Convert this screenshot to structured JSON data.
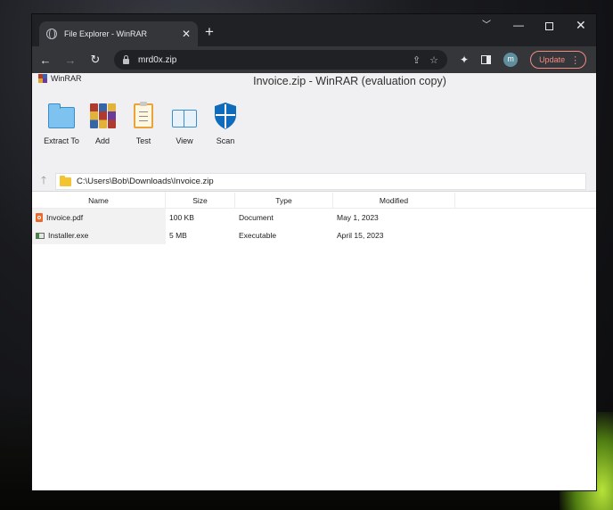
{
  "browser": {
    "tab_title": "File Explorer - WinRAR",
    "tab_close_glyph": "✕",
    "new_tab_glyph": "+",
    "url": "mrd0x.zip",
    "avatar_initial": "m",
    "update_label": "Update",
    "nav": {
      "back": "←",
      "forward": "→",
      "reload": "↻"
    }
  },
  "app": {
    "brand": "WinRAR",
    "window_title": "Invoice.zip - WinRAR (evaluation copy)",
    "tools": [
      {
        "label": "Extract To",
        "icon": "folder-icon"
      },
      {
        "label": "Add",
        "icon": "books-icon"
      },
      {
        "label": "Test",
        "icon": "clipboard-icon"
      },
      {
        "label": "View",
        "icon": "book-icon"
      },
      {
        "label": "Scan",
        "icon": "shield-icon"
      }
    ],
    "path": "C:\\Users\\Bob\\Downloads\\Invoice.zip",
    "columns": [
      "Name",
      "Size",
      "Type",
      "Modified"
    ],
    "files": [
      {
        "name": "Invoice.pdf",
        "size": "100 KB",
        "type": "Document",
        "modified": "May 1, 2023",
        "icon": "pdf-icon"
      },
      {
        "name": "Installer.exe",
        "size": "5 MB",
        "type": "Executable",
        "modified": "April 15, 2023",
        "icon": "exe-icon"
      }
    ]
  },
  "colors": {
    "chrome_dark": "#202124",
    "chrome_toolbar": "#35363a",
    "update_accent": "#f28b82",
    "ribbon_bg": "#f0f0f3",
    "shield_blue": "#0f6cbd"
  }
}
